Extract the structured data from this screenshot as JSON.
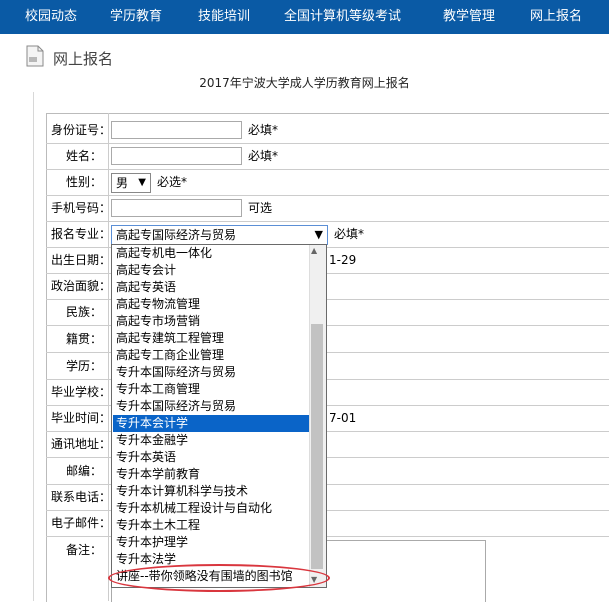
{
  "nav": {
    "items": [
      "校园动态",
      "学历教育",
      "技能培训",
      "全国计算机等级考试",
      "教学管理",
      "网上报名"
    ],
    "color": "#0a5aa5"
  },
  "page": {
    "title": "网上报名",
    "form_heading": "2017年宁波大学成人学历教育网上报名"
  },
  "form": {
    "id_label": "身份证号：",
    "id_note": "必填*",
    "name_label": "姓名：",
    "name_note": "必填*",
    "gender_label": "性别：",
    "gender_value": "男",
    "gender_note": "必选*",
    "phone_label": "手机号码：",
    "phone_note": "可选",
    "major_label": "报名专业：",
    "major_value": "高起专国际经济与贸易",
    "major_note": "必填*",
    "birth_label": "出生日期：",
    "birth_partial": "1-29",
    "politics_label": "政治面貌：",
    "ethnic_label": "民族：",
    "native_label": "籍贯：",
    "education_label": "学历：",
    "school_label": "毕业学校：",
    "grad_time_label": "毕业时间：",
    "grad_time_partial": "7-01",
    "address_label": "通讯地址：",
    "postcode_label": "邮编：",
    "contact_label": "联系电话：",
    "email_label": "电子邮件：",
    "remarks_label": "备注："
  },
  "dropdown": {
    "options": [
      "高起专机电一体化",
      "高起专会计",
      "高起专英语",
      "高起专物流管理",
      "高起专市场营销",
      "高起专建筑工程管理",
      "高起专工商企业管理",
      "专升本国际经济与贸易",
      "专升本工商管理",
      "专升本国际经济与贸易",
      "专升本会计学",
      "专升本金融学",
      "专升本英语",
      "专升本学前教育",
      "专升本计算机科学与技术",
      "专升本机械工程设计与自动化",
      "专升本土木工程",
      "专升本护理学",
      "专升本法学",
      "讲座--带你领略没有围墙的图书馆"
    ],
    "selected_index": 10,
    "highlight_color": "#0a64c8",
    "annotation_color": "#d9363e"
  }
}
